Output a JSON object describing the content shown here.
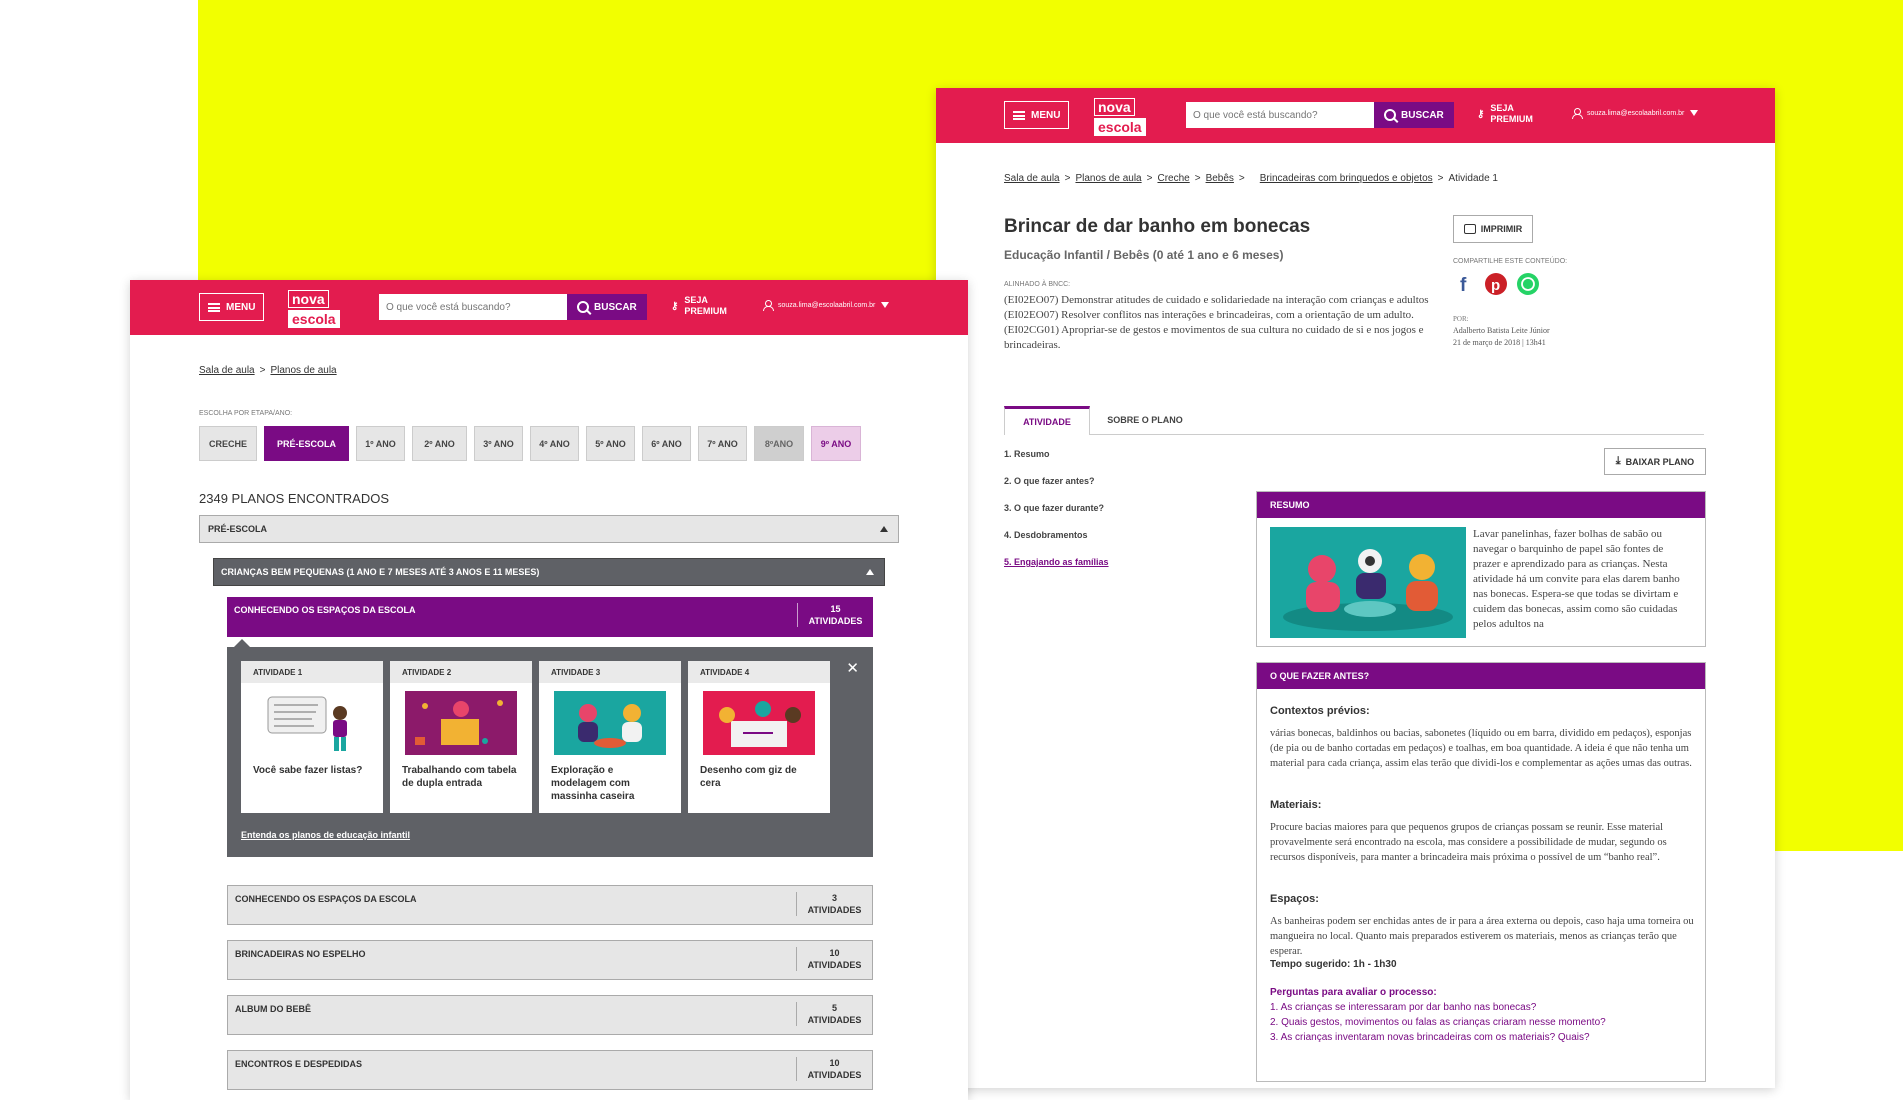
{
  "colors": {
    "brand": "#e31c4f",
    "accent": "#7a0b84",
    "background": "#f2ff00"
  },
  "header": {
    "menu_label": "MENU",
    "logo_line1": "nova",
    "logo_line2": "escola",
    "search_placeholder": "O que você está buscando?",
    "search_button": "BUSCAR",
    "premium_line1": "SEJA",
    "premium_line2": "PREMIUM",
    "user_email": "souza.lima@escolaabril.com.br"
  },
  "plan_page": {
    "breadcrumb": [
      "Sala de aula",
      "Planos de aula",
      "Creche",
      "Bebês",
      "Brincadeiras com brinquedos e objetos"
    ],
    "breadcrumb_current": "Atividade 1",
    "title": "Brincar de dar banho em bonecas",
    "subtitle": "Educação Infantil / Bebês (0 até 1 ano e 6 meses)",
    "bncc_label": "ALINHADO À BNCC:",
    "bncc_text": "(EI02EO07) Demonstrar atitudes de cuidado e solidariedade na interação com crianças e adultos (EI02EO07) Resolver conflitos nas interações e brincadeiras, com a orientação de um adulto.(EI02CG01) Apropriar-se de gestos e movimentos de sua cultura no cuidado de si e nos jogos e brincadeiras.",
    "print_button": "IMPRIMIR",
    "share_label": "COMPARTILHE ESTE CONTEÚDO:",
    "author_label": "POR:",
    "author_name": "Adalberto Batista Leite Júnior",
    "author_date": "21 de março de 2018 | 13h41",
    "tabs": [
      "ATIVIDADE",
      "SOBRE O PLANO"
    ],
    "download_button": "BAIXAR PLANO",
    "toc": [
      "1. Resumo",
      "2. O que fazer antes?",
      "3. O que fazer durante?",
      "4. Desdobramentos",
      "5. Engajando as famílias"
    ],
    "resumo_title": "RESUMO",
    "resumo_text": "Lavar panelinhas, fazer bolhas de sabão ou navegar o barquinho de papel são fontes de prazer e aprendizado para as crianças. Nesta atividade há um convite para elas darem banho nas bonecas. Espera-se que todas se divirtam e cuidem das bonecas, assim como são cuidadas pelos adultos na",
    "antes_title": "O QUE FAZER ANTES?",
    "contextos_title": "Contextos prévios:",
    "contextos_text": "várias bonecas, baldinhos ou bacias, sabonetes (líquido ou em barra, dividido em pedaços), esponjas (de pia ou de banho cortadas em pedaços) e toalhas, em boa quantidade. A ideia é que não tenha um material para cada criança, assim elas terão que dividi-los e complementar as ações umas das outras.",
    "materiais_title": "Materiais:",
    "materiais_text": "Procure bacias maiores para que pequenos grupos de crianças possam se reunir. Esse material provavelmente será encontrado na escola, mas considere a possibilidade de mudar, segundo os recursos disponíveis, para manter a brincadeira mais próxima o possível de um “banho real”.",
    "espacos_title": "Espaços:",
    "espacos_text": "As banheiras podem ser enchidas antes de ir para a área externa ou depois, caso haja uma torneira ou mangueira no local. Quanto mais preparados estiverem os materiais, menos as crianças terão que esperar.",
    "tempo": "Tempo sugerido: 1h - 1h30",
    "perguntas_title": "Perguntas para avaliar o processo:",
    "perguntas": [
      "1. As crianças se interessaram por dar  banho nas bonecas?",
      "2. Quais gestos, movimentos ou falas as crianças criaram nesse momento?",
      "3. As crianças inventaram novas brincadeiras com os materiais? Quais?"
    ]
  },
  "list_page": {
    "breadcrumb": [
      "Sala de aula",
      "Planos de aula"
    ],
    "filter_label": "ESCOLHA POR ETAPA/ANO:",
    "filters": [
      "CRECHE",
      "PRÉ-ESCOLA",
      "1º ANO",
      "2º ANO",
      "3º ANO",
      "4º ANO",
      "5º ANO",
      "6º ANO",
      "7º ANO",
      "8ºANO",
      "9º ANO"
    ],
    "selected_filter": "PRÉ-ESCOLA",
    "count_text": "2349 PLANOS ENCONTRADOS",
    "section1": "PRÉ-ESCOLA",
    "section2": "CRIANÇAS BEM PEQUENAS (1 ANO E 7 MESES ATÉ 3 ANOS E 11 MESES)",
    "open_group": {
      "title": "CONHECENDO OS ESPAÇOS DA ESCOLA",
      "count": "15",
      "count_label": "ATIVIDADES"
    },
    "cards": [
      {
        "label": "ATIVIDADE 1",
        "title": "Você sabe fazer listas?"
      },
      {
        "label": "ATIVIDADE 2",
        "title": "Trabalhando com tabela de dupla entrada"
      },
      {
        "label": "ATIVIDADE 3",
        "title": "Exploração e modelagem com massinha caseira"
      },
      {
        "label": "ATIVIDADE 4",
        "title": "Desenho com giz de cera"
      }
    ],
    "info_link": "Entenda os planos de educação infantil",
    "groups": [
      {
        "title": "CONHECENDO OS ESPAÇOS DA ESCOLA",
        "count": "3",
        "count_label": "ATIVIDADES"
      },
      {
        "title": "BRINCADEIRAS NO ESPELHO",
        "count": "10",
        "count_label": "ATIVIDADES"
      },
      {
        "title": "ALBUM DO BEBÊ",
        "count": "5",
        "count_label": "ATIVIDADES"
      },
      {
        "title": "ENCONTROS E DESPEDIDAS",
        "count": "10",
        "count_label": "ATIVIDADES"
      }
    ]
  }
}
